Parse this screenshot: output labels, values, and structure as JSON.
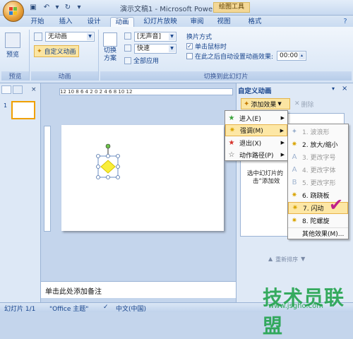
{
  "window": {
    "title": "演示文稿1 - Microsoft PowerPoint",
    "contextual_tab": "绘图工具"
  },
  "tabs": [
    "开始",
    "插入",
    "设计",
    "动画",
    "幻灯片放映",
    "审阅",
    "视图",
    "格式"
  ],
  "active_tab": "动画",
  "ribbon": {
    "preview": {
      "button": "预览",
      "group": "预览"
    },
    "animation": {
      "combo_value": "无动画",
      "custom_button": "自定义动画",
      "group": "动画"
    },
    "transition": {
      "scheme_label": "切换\n方案",
      "sound_value": "[无声音]",
      "speed_value": "快速",
      "apply_all": "全部应用",
      "mode_title": "换片方式",
      "on_click": "单击鼠标时",
      "auto_after": "在此之后自动设置动画效果:",
      "time_value": "00:00",
      "group": "切换到此幻灯片"
    }
  },
  "ruler_text": "12 10 8 6 4 2 0 2 4 6 8 10 12",
  "notes_placeholder": "单击此处添加备注",
  "custom_anim": {
    "title": "自定义动画",
    "add_effect": "添加效果",
    "remove": "删除",
    "hint": "选中幻灯片的某个元素，然后单击“添加效果”",
    "reorder": "重新排序",
    "hint_line1": "选中幻灯片的",
    "hint_line2": "击“添加效"
  },
  "effect_menu": [
    {
      "label": "进入(E)",
      "icon": "star-green"
    },
    {
      "label": "强调(M)",
      "icon": "star-yellow",
      "highlighted": true
    },
    {
      "label": "退出(X)",
      "icon": "star-red"
    },
    {
      "label": "动作路径(P)",
      "icon": "star-outline"
    }
  ],
  "emphasis_menu": [
    {
      "label": "1. 波浪形",
      "disabled": true
    },
    {
      "label": "2. 放大/缩小",
      "disabled": false
    },
    {
      "label": "3. 更改字号",
      "disabled": true
    },
    {
      "label": "4. 更改字体",
      "disabled": true
    },
    {
      "label": "5. 更改字形",
      "disabled": true
    },
    {
      "label": "6. 跷跷板",
      "disabled": false
    },
    {
      "label": "7. 闪动",
      "disabled": false,
      "highlighted": true
    },
    {
      "label": "8. 陀螺旋",
      "disabled": false
    },
    {
      "label": "其他效果(M)...",
      "disabled": false
    }
  ],
  "status": {
    "slide": "幻灯片 1/1",
    "theme": "\"Office 主题\"",
    "lang": "中文(中国)"
  },
  "watermark": {
    "main": "技术员联盟",
    "sub": "www.jsgho.com"
  },
  "colors": {
    "accent": "#15428b",
    "highlight": "#fde7a5",
    "check": "#c0208a"
  }
}
